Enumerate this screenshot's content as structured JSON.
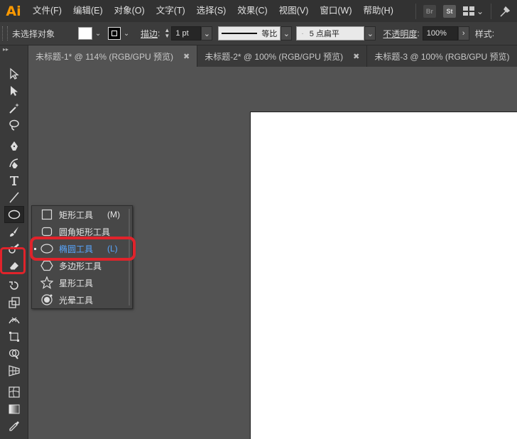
{
  "app": {
    "logo": "Ai"
  },
  "menubar": {
    "items": [
      "文件(F)",
      "编辑(E)",
      "对象(O)",
      "文字(T)",
      "选择(S)",
      "效果(C)",
      "视图(V)",
      "窗口(W)",
      "帮助(H)"
    ],
    "bridge_icon": "Br",
    "stock_icon": "St",
    "workspace_arrow": "⌄"
  },
  "controlbar": {
    "selection_label": "未选择对象",
    "stroke_label": "描边",
    "stroke_weight": "1 pt",
    "stroke_ratio_label": "等比",
    "profile_label": "5 点扁平",
    "opacity_label": "不透明度",
    "opacity_value": "100%",
    "style_label": "样式"
  },
  "tabs": [
    {
      "label": "未标题-1* @ 114% (RGB/GPU 预览)",
      "close": "✖",
      "active": true
    },
    {
      "label": "未标题-2* @ 100% (RGB/GPU 预览)",
      "close": "✖",
      "active": false
    },
    {
      "label": "未标题-3 @ 100% (RGB/GPU 预览)",
      "close": "✖",
      "active": false
    }
  ],
  "toolbar": {
    "header": "▸▸",
    "tools": [
      "selection-icon",
      "direct-selection-icon",
      "magic-wand-icon",
      "lasso-icon",
      "pen-icon",
      "curvature-icon",
      "type-icon",
      "line-icon",
      "ellipse-icon",
      "brush-icon",
      "shaper-icon",
      "eraser-icon",
      "rotate-icon",
      "scale-icon",
      "width-icon",
      "free-transform-icon",
      "shape-builder-icon",
      "perspective-icon",
      "mesh-icon",
      "gradient-icon",
      "eyedropper-icon"
    ],
    "selected_tool": "ellipse-icon"
  },
  "flyout": {
    "items": [
      {
        "label": "矩形工具",
        "key": "(M)",
        "icon": "rectangle-icon"
      },
      {
        "label": "圆角矩形工具",
        "key": "",
        "icon": "rounded-rectangle-icon"
      },
      {
        "label": "椭圆工具",
        "key": "(L)",
        "icon": "ellipse-icon",
        "active": true
      },
      {
        "label": "多边形工具",
        "key": "",
        "icon": "polygon-icon"
      },
      {
        "label": "星形工具",
        "key": "",
        "icon": "star-icon"
      },
      {
        "label": "光晕工具",
        "key": "",
        "icon": "flare-icon"
      }
    ]
  },
  "colors": {
    "accent_highlight": "#e0232b",
    "active_item_text": "#58a7ff",
    "logo": "#ff9a00"
  }
}
